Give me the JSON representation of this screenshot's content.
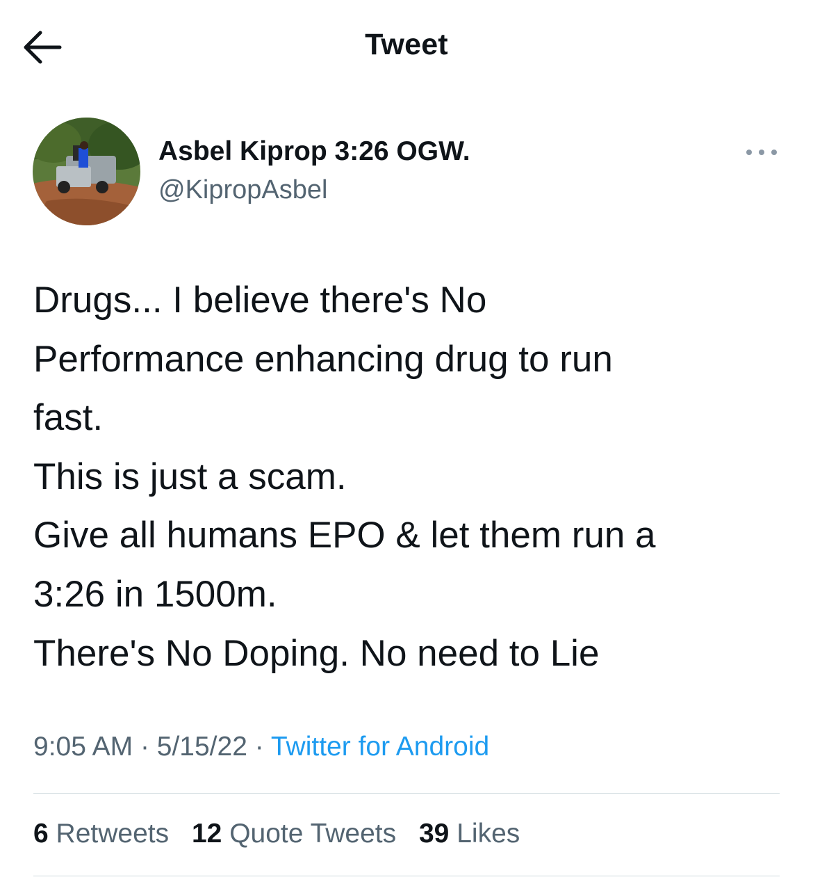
{
  "header": {
    "back_icon": "arrow-left-icon",
    "title": "Tweet"
  },
  "tweet": {
    "author_name": "Asbel Kiprop 3:26 OGW.",
    "handle": "@KipropAsbel",
    "more_icon": "more-dots-icon",
    "text_lines": [
      "Drugs... I believe there's No",
      "Performance enhancing drug to run",
      "fast.",
      "This is just a scam.",
      "Give all humans EPO & let them run a",
      "3:26 in 1500m.",
      "There's No Doping. No need to Lie"
    ],
    "time": "9:05 AM",
    "separator": "·",
    "date": "5/15/22",
    "source": "Twitter for Android"
  },
  "stats": {
    "retweets_count": "6",
    "retweets_label": "Retweets",
    "quotes_count": "12",
    "quotes_label": "Quote Tweets",
    "likes_count": "39",
    "likes_label": "Likes"
  },
  "colors": {
    "text": "#0f1419",
    "secondary": "#536471",
    "link": "#1d9bf0",
    "divider": "#cfd9de"
  }
}
